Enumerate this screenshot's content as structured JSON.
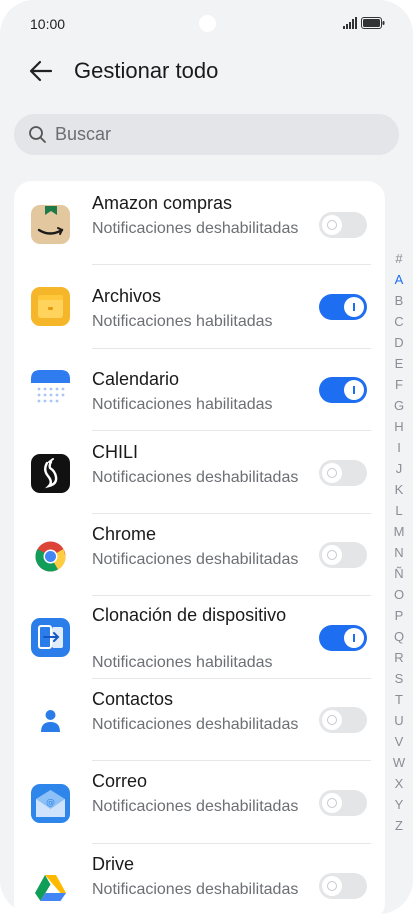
{
  "status_bar": {
    "time": "10:00"
  },
  "header": {
    "title": "Gestionar todo"
  },
  "search": {
    "placeholder": "Buscar"
  },
  "apps": [
    {
      "name": "Amazon compras",
      "status": "Notificaciones deshabilitadas",
      "enabled": false,
      "icon": "amazon-icon"
    },
    {
      "name": "Archivos",
      "status": "Notificaciones habilitadas",
      "enabled": true,
      "icon": "files-icon"
    },
    {
      "name": "Calendario",
      "status": "Notificaciones habilitadas",
      "enabled": true,
      "icon": "calendar-icon"
    },
    {
      "name": "CHILI",
      "status": "Notificaciones deshabilitadas",
      "enabled": false,
      "icon": "chili-icon"
    },
    {
      "name": "Chrome",
      "status": "Notificaciones deshabilitadas",
      "enabled": false,
      "icon": "chrome-icon"
    },
    {
      "name": "Clonación de dispositivo",
      "status": "Notificaciones habilitadas",
      "enabled": true,
      "icon": "device-clone-icon"
    },
    {
      "name": "Contactos",
      "status": "Notificaciones deshabilitadas",
      "enabled": false,
      "icon": "contacts-icon"
    },
    {
      "name": "Correo",
      "status": "Notificaciones deshabilitadas",
      "enabled": false,
      "icon": "mail-icon"
    },
    {
      "name": "Drive",
      "status": "Notificaciones deshabilitadas",
      "enabled": false,
      "icon": "drive-icon"
    }
  ],
  "index_letters": [
    "#",
    "A",
    "B",
    "C",
    "D",
    "E",
    "F",
    "G",
    "H",
    "I",
    "J",
    "K",
    "L",
    "M",
    "N",
    "Ñ",
    "O",
    "P",
    "Q",
    "R",
    "S",
    "T",
    "U",
    "V",
    "W",
    "X",
    "Y",
    "Z"
  ],
  "index_active": "A",
  "colors": {
    "accent": "#1d6ef0",
    "background": "#f1f3f5",
    "card": "#ffffff"
  }
}
